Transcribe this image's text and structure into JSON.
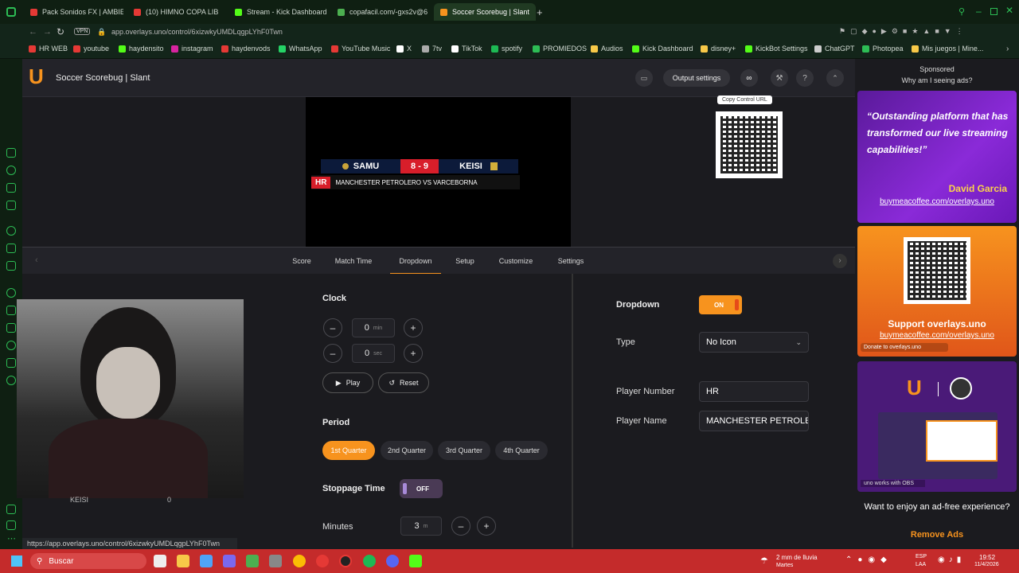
{
  "browser": {
    "tabs": [
      {
        "title": "Pack Sonidos FX | AMBIEN",
        "color": "#e53935"
      },
      {
        "title": "(10) HIMNO COPA LIB",
        "color": "#e53935"
      },
      {
        "title": "Stream - Kick Dashboard",
        "color": "#53fc18"
      },
      {
        "title": "copafacil.com/-gxs2v@6",
        "color": "#4caf50"
      },
      {
        "title": "Soccer Scorebug | Slant",
        "color": "#f7931e"
      }
    ],
    "url": "app.overlays.uno/control/6xizwkyUMDLqgpLYhF0Twn",
    "vpn": "VPN",
    "bookmarks": [
      "HR WEB",
      "youtube",
      "haydensito",
      "instagram",
      "haydenvods",
      "WhatsApp",
      "YouTube Music",
      "X",
      "7tv",
      "TikTok",
      "spotify",
      "PROMIEDOS",
      "Audios",
      "Kick Dashboard",
      "disney+",
      "KickBot Settings",
      "ChatGPT",
      "Photopea",
      "Mis juegos | Mine..."
    ]
  },
  "app": {
    "logo": "U",
    "title": "Soccer Scorebug | Slant",
    "output_settings": "Output settings",
    "tooltip": "Copy Control URL"
  },
  "scorebug": {
    "home": "SAMU",
    "score": "8 - 9",
    "away": "KEISI",
    "tag": "HR",
    "subtitle": "MANCHESTER PETROLERO VS VARCEBORNA"
  },
  "tabs": [
    "Score",
    "Match Time",
    "Dropdown",
    "Setup",
    "Customize",
    "Settings"
  ],
  "active_tab": "Dropdown",
  "clock": {
    "label": "Clock",
    "min_value": "0",
    "min_unit": "min",
    "sec_value": "0",
    "sec_unit": "sec",
    "play": "Play",
    "reset": "Reset"
  },
  "period": {
    "label": "Period",
    "options": [
      "1st Quarter",
      "2nd Quarter",
      "3rd Quarter",
      "4th Quarter"
    ],
    "selected": "1st Quarter"
  },
  "stoppage": {
    "label": "Stoppage Time",
    "toggle": "OFF"
  },
  "minutes": {
    "label": "Minutes",
    "value": "3",
    "unit": "m"
  },
  "dropdown": {
    "label": "Dropdown",
    "toggle": "ON",
    "type_label": "Type",
    "type_value": "No Icon",
    "player_number_label": "Player Number",
    "player_number": "HR",
    "player_name_label": "Player Name",
    "player_name": "MANCHESTER PETROLE"
  },
  "left_panel": {
    "team_label": "KEISI",
    "value": "0"
  },
  "status_url": "https://app.overlays.uno/control/6xizwkyUMDLqgpLYhF0Twn",
  "ads": {
    "sponsored": "Sponsored",
    "why": "Why am I seeing ads?",
    "quote": "“Outstanding platform that has transformed our live streaming capabilities!”",
    "author": "David Garcia",
    "link1": "buymeacoffee.com/overlays.uno",
    "support": "Support overlays.uno",
    "link2": "buymeacoffee.com/overlays.uno",
    "donate": "Donate to overlays.uno",
    "obs_caption": "uno works with OBS",
    "want": "Want to enjoy an ad-free experience?",
    "remove": "Remove Ads"
  },
  "taskbar": {
    "search": "Buscar",
    "weather": "2 mm de lluvia",
    "weather_day": "Martes",
    "lang1": "ESP",
    "lang2": "LAA",
    "time": "19:52",
    "date": "11/4/2026"
  }
}
